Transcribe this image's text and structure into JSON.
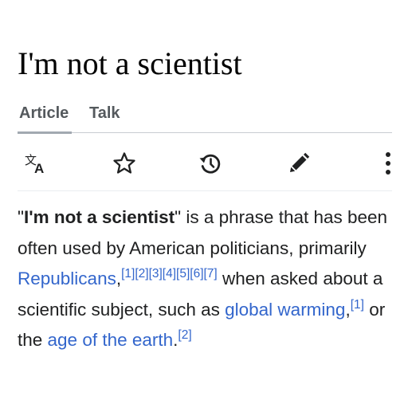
{
  "page": {
    "title": "I'm not a scientist"
  },
  "tabs": [
    {
      "label": "Article",
      "selected": true
    },
    {
      "label": "Talk",
      "selected": false
    }
  ],
  "toolbar": {
    "icons": [
      "language-icon",
      "star-icon",
      "history-icon",
      "edit-pencil-icon",
      "more-vertical-icon"
    ]
  },
  "article": {
    "quote_open": "\"",
    "bold_phrase": "I'm not a scientist",
    "text_1": "\" is a phrase that has been often used by American politicians, primarily ",
    "link_republicans": "Republicans",
    "text_2": ",",
    "refs_1": [
      "[1]",
      "[2]",
      "[3]",
      "[4]",
      "[5]",
      "[6]",
      "[7]"
    ],
    "text_3": " when asked about a scientific subject, such as ",
    "link_global_warming": "global warming",
    "text_4": ",",
    "ref_2": "[1]",
    "text_5": " or the ",
    "link_age_of_earth": "age of the earth",
    "text_6": ".",
    "ref_3": "[2]"
  },
  "colors": {
    "link": "#3366cc",
    "text": "#202122",
    "icon": "#202122",
    "tab_text": "#54595d"
  }
}
